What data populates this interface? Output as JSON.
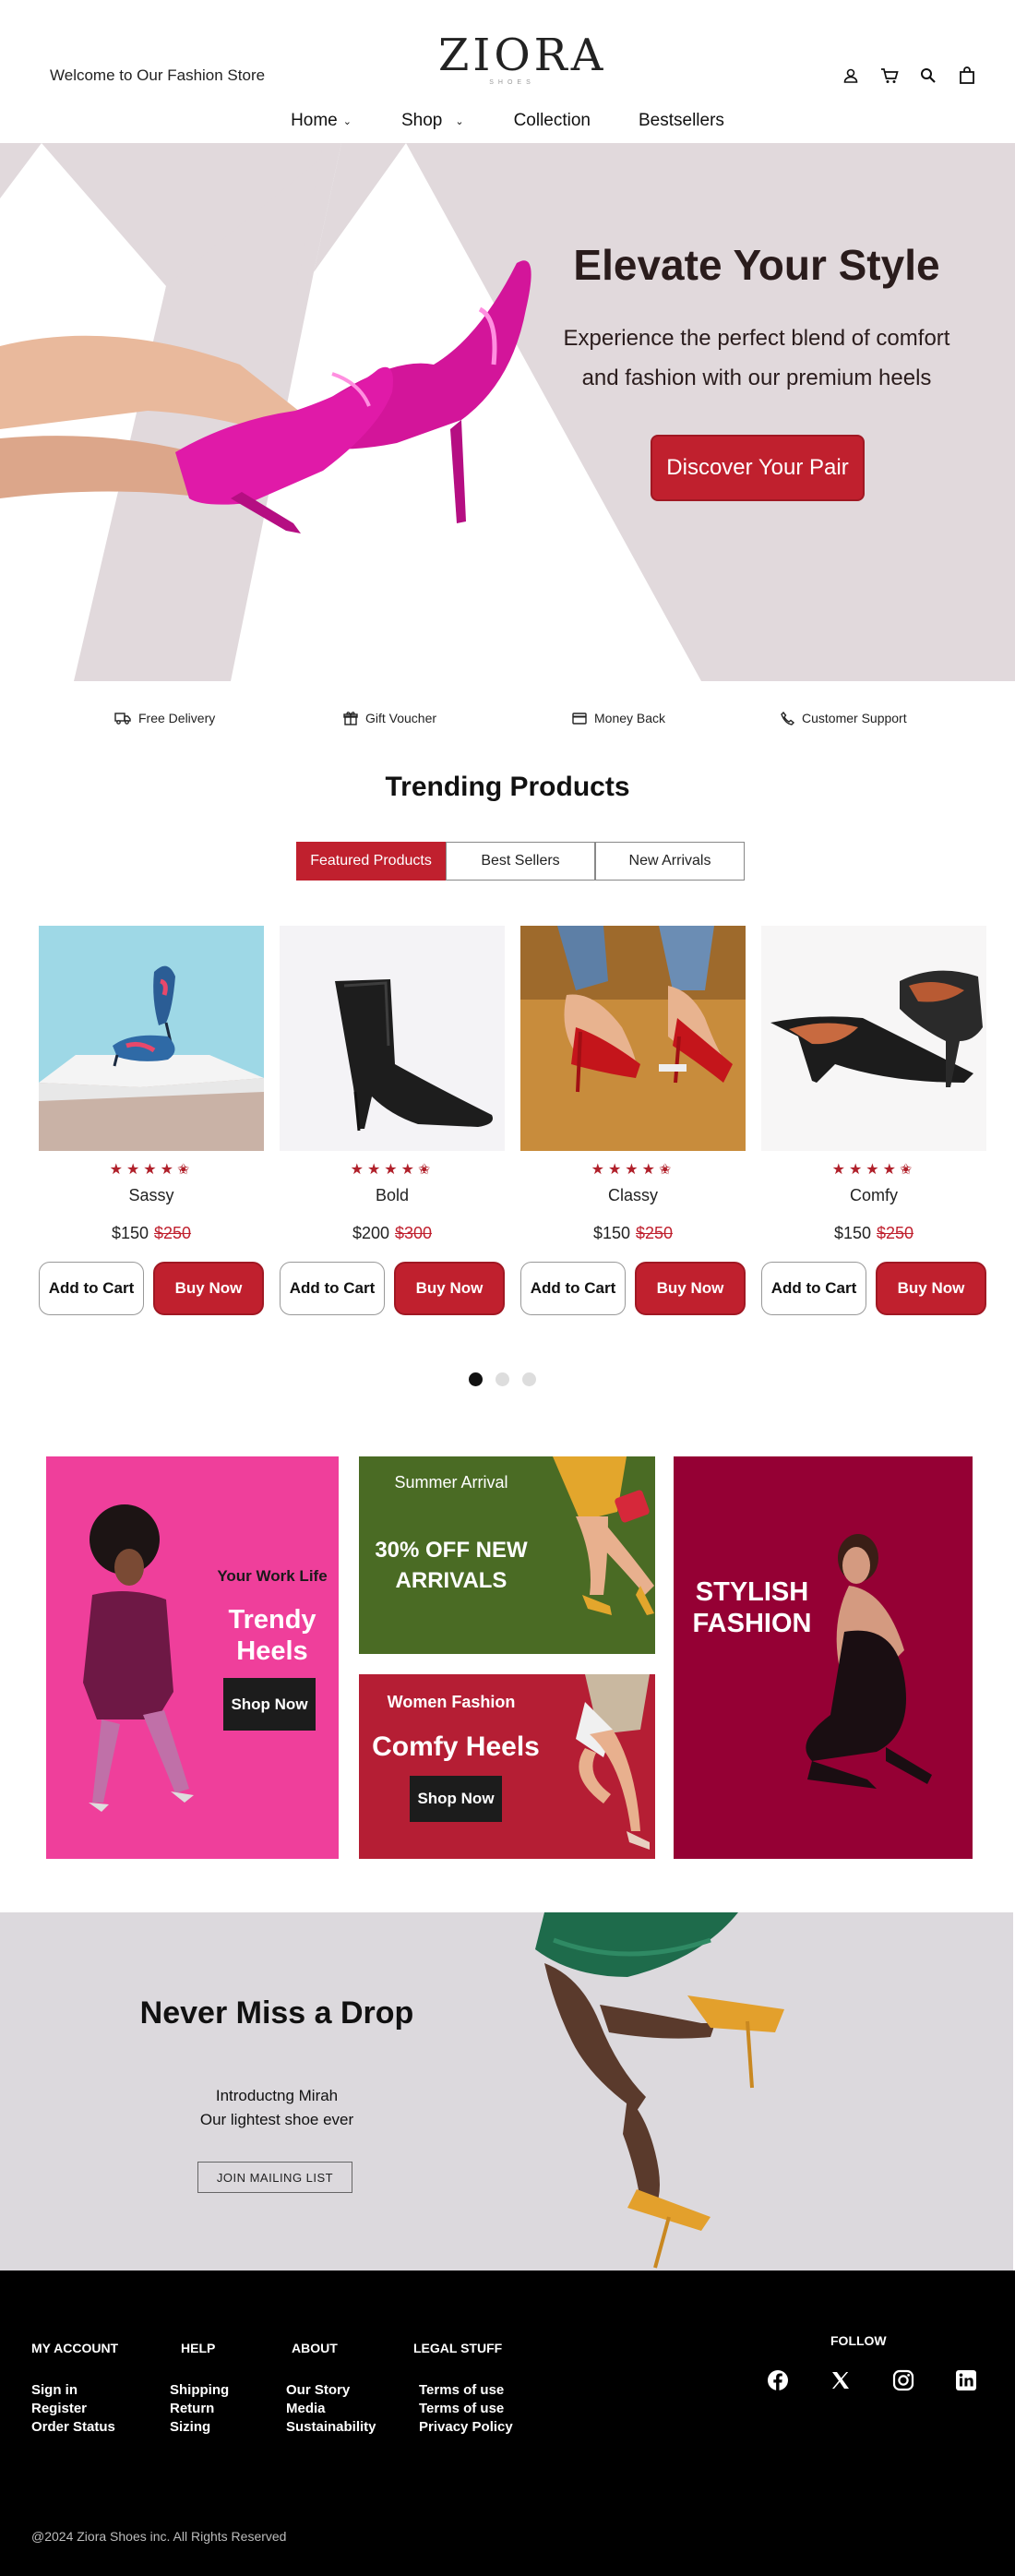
{
  "header": {
    "welcome": "Welcome to Our Fashion Store",
    "logo": "ZIORA",
    "logo_sub": "SHOES",
    "icons": [
      "user-icon",
      "cart-icon",
      "search-icon",
      "bag-icon"
    ]
  },
  "nav": {
    "items": [
      {
        "label": "Home",
        "dropdown": true
      },
      {
        "label": "Shop",
        "dropdown": true
      },
      {
        "label": "Collection",
        "dropdown": false
      },
      {
        "label": "Bestsellers",
        "dropdown": false
      }
    ]
  },
  "hero": {
    "title": "Elevate Your Style",
    "text": "Experience the perfect blend of comfort and fashion with our premium heels",
    "cta": "Discover Your Pair"
  },
  "features": [
    {
      "icon": "truck-icon",
      "label": "Free Delivery"
    },
    {
      "icon": "gift-icon",
      "label": "Gift Voucher"
    },
    {
      "icon": "card-icon",
      "label": "Money Back"
    },
    {
      "icon": "phone-icon",
      "label": "Customer Support"
    }
  ],
  "trending": {
    "title": "Trending Products",
    "tabs": [
      {
        "label": "Featured Products",
        "active": true
      },
      {
        "label": "Best Sellers",
        "active": false
      },
      {
        "label": "New Arrivals",
        "active": false
      }
    ],
    "products": [
      {
        "name": "Sassy",
        "price": "$150",
        "old_price": "$250",
        "rating": 4.5
      },
      {
        "name": "Bold",
        "price": "$200",
        "old_price": "$300",
        "rating": 4.5
      },
      {
        "name": "Classy",
        "price": "$150",
        "old_price": "$250",
        "rating": 4.5
      },
      {
        "name": "Comfy",
        "price": "$150",
        "old_price": "$250",
        "rating": 4.5
      }
    ],
    "add_to_cart": "Add to Cart",
    "buy_now": "Buy Now",
    "carousel_pages": 3,
    "carousel_active": 1
  },
  "promos": {
    "work": {
      "kicker": "Your Work Life",
      "title_line1": "Trendy",
      "title_line2": "Heels",
      "cta": "Shop Now"
    },
    "summer": {
      "kicker": "Summer Arrival",
      "title_line1": "30% OFF NEW",
      "title_line2": "ARRIVALS"
    },
    "women": {
      "kicker": "Women Fashion",
      "title": "Comfy Heels",
      "cta": "Shop Now"
    },
    "stylish": {
      "title_line1": "STYLISH",
      "title_line2": "FASHION"
    }
  },
  "newsletter": {
    "title": "Never Miss a Drop",
    "line1": "Introductng Mirah",
    "line2": "Our lightest shoe ever",
    "cta": "JOIN MAILING LIST"
  },
  "footer": {
    "columns": [
      {
        "title": "MY ACCOUNT",
        "links": [
          "Sign in",
          "Register",
          "Order Status"
        ]
      },
      {
        "title": "HELP",
        "links": [
          "Shipping",
          "Return",
          "Sizing"
        ]
      },
      {
        "title": "ABOUT",
        "links": [
          "Our Story",
          "Media",
          "Sustainability"
        ]
      },
      {
        "title": "LEGAL STUFF",
        "links": [
          "Terms of use",
          "Terms of use",
          "Privacy Policy"
        ]
      }
    ],
    "follow": "FOLLOW",
    "socials": [
      "facebook-icon",
      "x-icon",
      "instagram-icon",
      "linkedin-icon"
    ],
    "copyright": "@2024 Ziora Shoes inc. All Rights Reserved"
  },
  "colors": {
    "accent": "#c0202e",
    "hero_bg": "#e1d9dc",
    "pink": "#ef3f9b",
    "green": "#4a6b24",
    "crimson": "#b51e34",
    "wine": "#950034",
    "newsletter_bg": "#dcd9dd",
    "footer_bg": "#000000"
  }
}
